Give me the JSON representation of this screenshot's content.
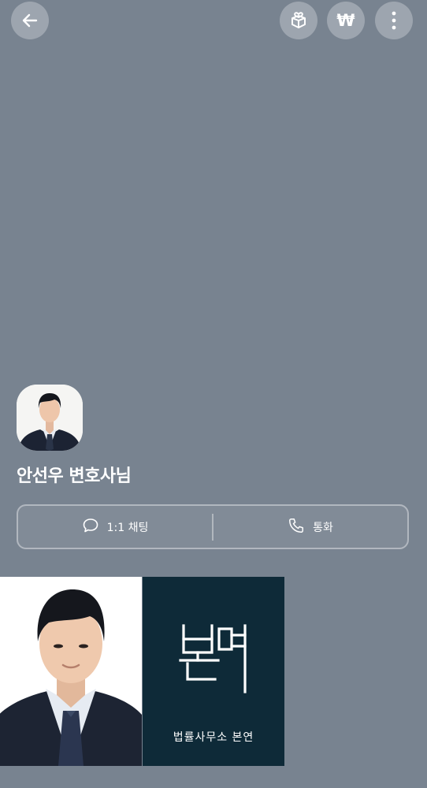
{
  "header": {
    "back_icon": "arrow-left-icon",
    "gift_icon": "gift-box-icon",
    "won_icon": "won-sign-icon",
    "won_symbol": "₩",
    "more_icon": "more-vertical-icon"
  },
  "profile": {
    "name": "안선우 변호사님"
  },
  "actions": {
    "chat_label": "1:1 채팅",
    "chat_icon": "chat-bubble-icon",
    "call_label": "통화",
    "call_icon": "phone-icon"
  },
  "gallery": {
    "logo_mark": "본연",
    "logo_caption": "법률사무소 본연"
  },
  "colors": {
    "background": "#788390",
    "logo_background": "#0e2a38",
    "text": "#ffffff"
  }
}
